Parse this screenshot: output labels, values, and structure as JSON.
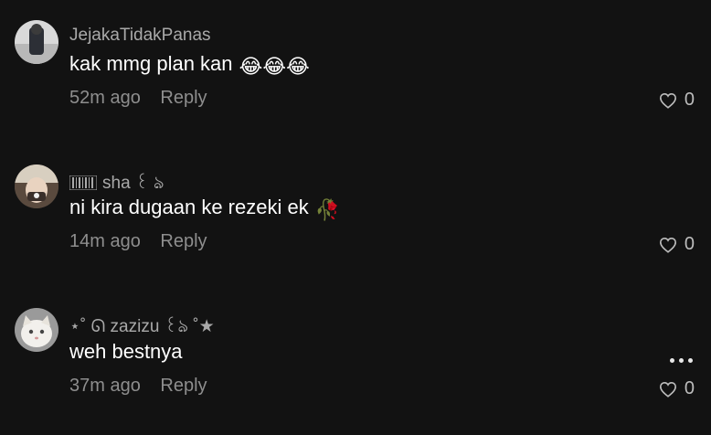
{
  "comments": [
    {
      "username": "JejakaTidakPanas",
      "text": "kak mmg plan kan",
      "emoji": "😂😂😂",
      "time": "52m ago",
      "reply_label": "Reply",
      "likes": "0"
    },
    {
      "username": "sha ꒰ ঌ",
      "text": "ni kira dugaan ke rezeki ek",
      "emoji": "🥀",
      "time": "14m ago",
      "reply_label": "Reply",
      "likes": "0"
    },
    {
      "username": "⋆˚ ᘏ zazizu ꒰ঌ ˚★",
      "text": "weh bestnya",
      "time": "37m ago",
      "reply_label": "Reply",
      "likes": "0"
    }
  ],
  "colors": {
    "background": "#121212",
    "username": "#a9a9a9",
    "meta": "#8e8e8e"
  },
  "icons": [
    "heart-icon",
    "more-options-icon"
  ]
}
